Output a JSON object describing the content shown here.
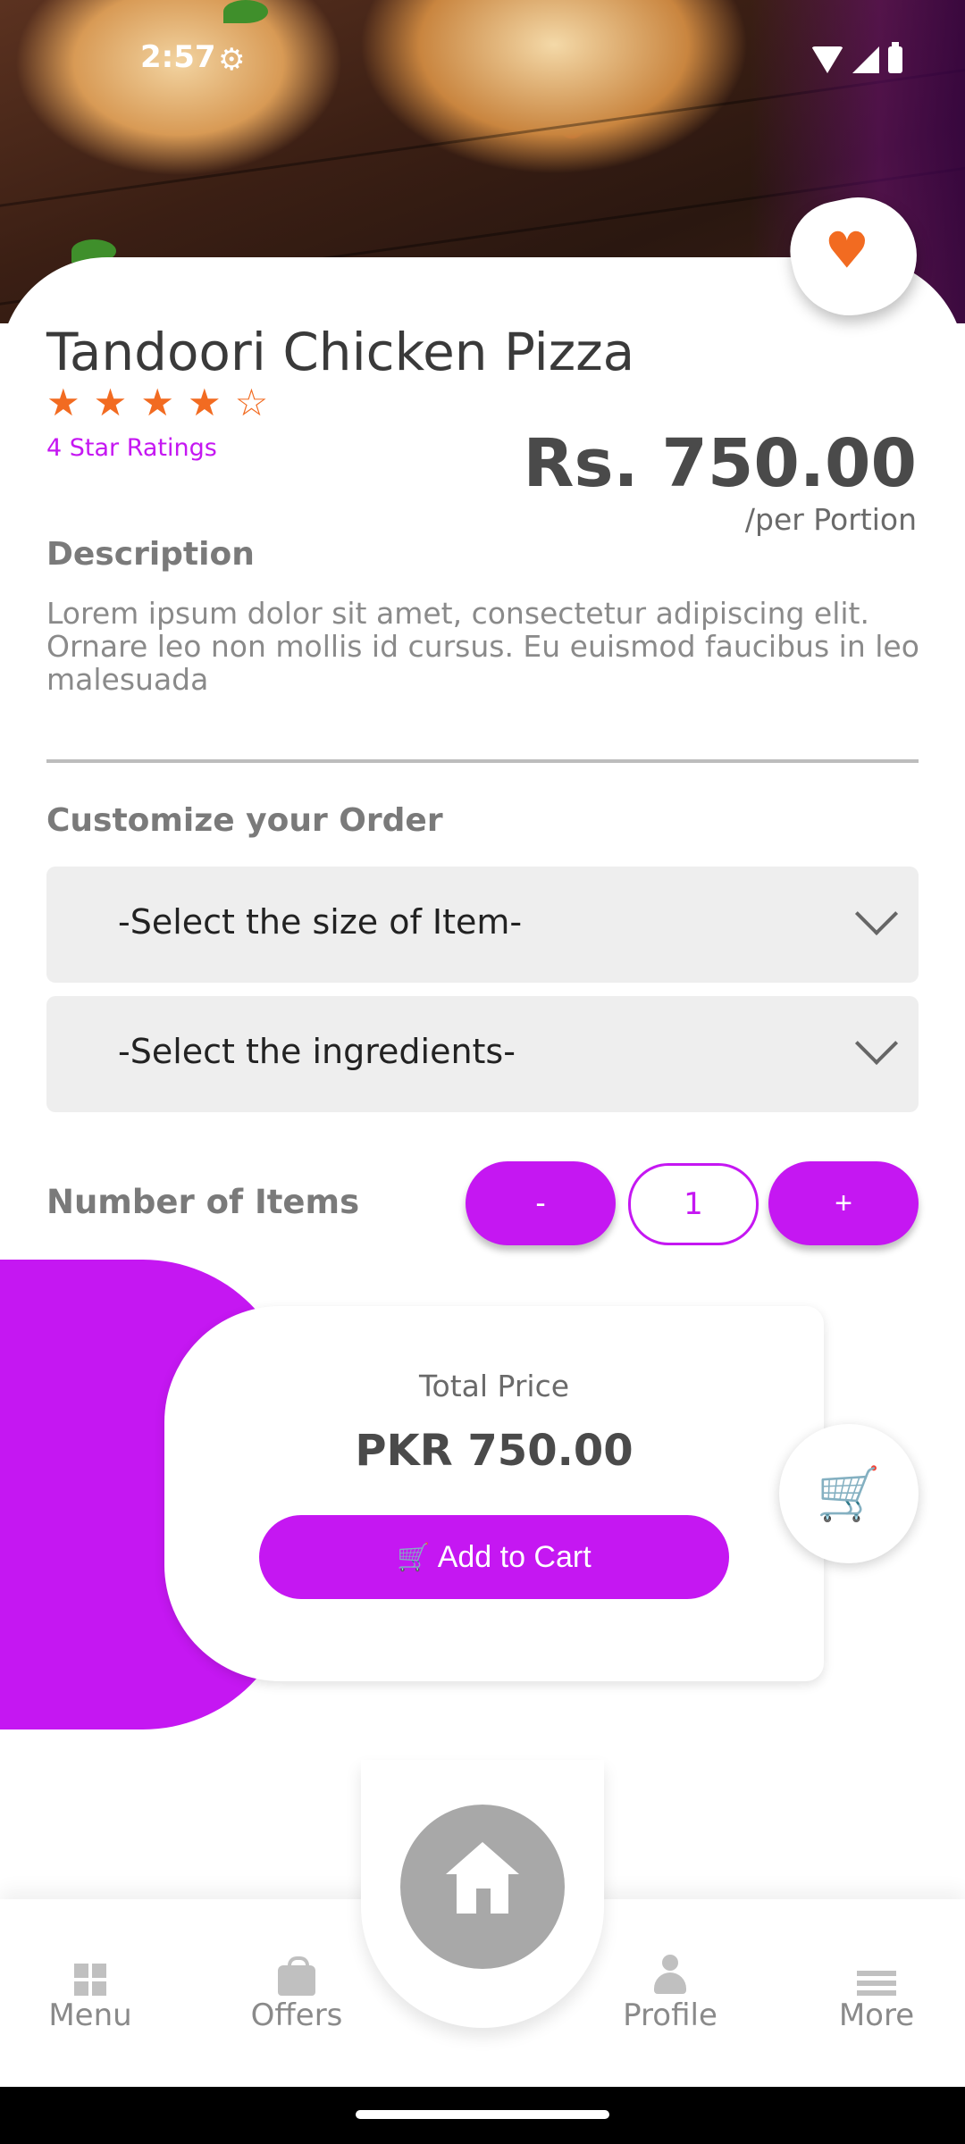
{
  "status_bar": {
    "time": "2:57"
  },
  "product": {
    "name": "Tandoori Chicken Pizza",
    "rating_stars": 4,
    "rating_max": 5,
    "rating_text": "4 Star Ratings",
    "price": "Rs. 750.00",
    "portion": "/per Portion",
    "description_title": "Description",
    "description": "Lorem ipsum dolor sit amet, consectetur adipiscing elit. Ornare leo non mollis id cursus. Eu euismod faucibus in leo malesuada"
  },
  "customize": {
    "title": "Customize your Order",
    "size_select": "-Select the size of Item-",
    "ingredients_select": "-Select the ingredients-"
  },
  "quantity": {
    "label": "Number of Items",
    "minus": "-",
    "value": "1",
    "plus": "+"
  },
  "total": {
    "label": "Total Price",
    "value": "PKR 750.00",
    "add_to_cart": "Add to Cart"
  },
  "bottom_nav": {
    "items": [
      {
        "label": "Menu",
        "icon": "grid-icon"
      },
      {
        "label": "Offers",
        "icon": "bag-icon"
      },
      {
        "label": "Profile",
        "icon": "user-icon"
      },
      {
        "label": "More",
        "icon": "menu-lines-icon"
      }
    ],
    "center": "home-icon"
  },
  "colors": {
    "accent": "#c517f2",
    "orange": "#f26b21",
    "text": "#4a4a4a"
  }
}
